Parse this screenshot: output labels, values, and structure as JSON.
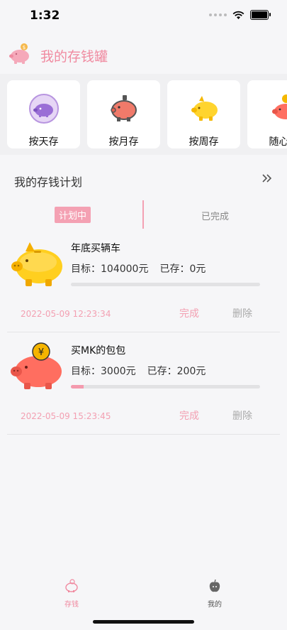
{
  "status": {
    "time": "1:32"
  },
  "header": {
    "title": "我的存钱罐"
  },
  "categories": [
    {
      "label": "按天存",
      "icon": "purple-pig-icon"
    },
    {
      "label": "按月存",
      "icon": "red-piggy-bank-icon"
    },
    {
      "label": "按周存",
      "icon": "yellow-pig-icon"
    },
    {
      "label": "随心所",
      "icon": "coin-pig-icon"
    }
  ],
  "plans": {
    "title": "我的存钱计划",
    "more_icon": "double-chevron-right-icon"
  },
  "tabs": {
    "active": "计划中",
    "inactive": "已完成"
  },
  "items": [
    {
      "name": "年底买辆车",
      "target_label": "目标：",
      "target": "104000元",
      "saved_label": "已存：",
      "saved": "0元",
      "progress": 0,
      "date": "2022-05-09 12:23:34",
      "done": "完成",
      "delete": "删除"
    },
    {
      "name": "买MK的包包",
      "target_label": "目标：",
      "target": "3000元",
      "saved_label": "已存：",
      "saved": "200元",
      "progress": 0.0667,
      "date": "2022-05-09 15:23:45",
      "done": "完成",
      "delete": "删除"
    }
  ],
  "tabbar": [
    {
      "label": "存钱",
      "icon": "piggy-bank-icon",
      "active": true
    },
    {
      "label": "我的",
      "icon": "apple-profile-icon",
      "active": false
    }
  ],
  "colors": {
    "accent": "#f4a1b3",
    "pink_text": "#f08aa0"
  }
}
